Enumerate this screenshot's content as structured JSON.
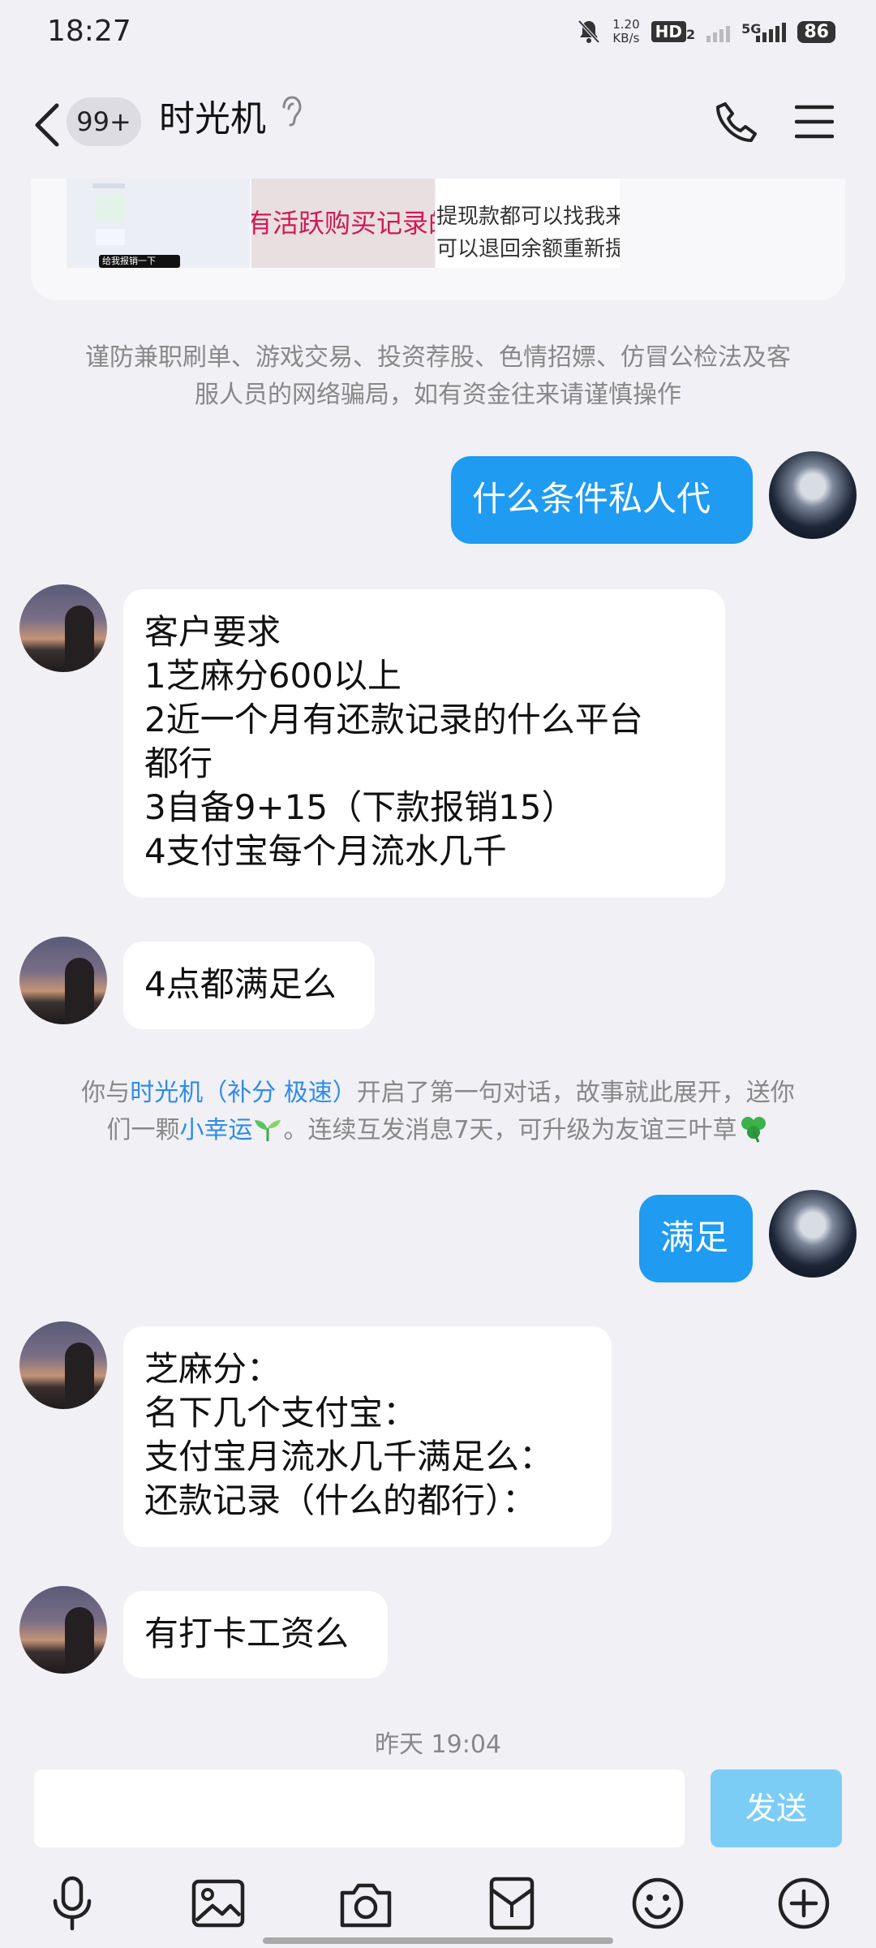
{
  "status_bar": {
    "time": "18:27",
    "net_speed_value": "1.20",
    "net_speed_unit": "KB/s",
    "hd_label": "HD",
    "hd_sub": "2",
    "network": "5G",
    "battery": "86"
  },
  "header": {
    "unread_count": "99+",
    "title": "时光机",
    "icons": [
      "back-arrow-icon",
      "ear-icon",
      "phone-icon",
      "menu-icon"
    ]
  },
  "image_preview": {
    "thumb2_text": "有活跃购买记录的来",
    "thumb3_line1": "提现款都可以找我来行",
    "thumb3_line2": "可以退回余额重新提现",
    "thumb1_button": "给我报销一下"
  },
  "system_warning": {
    "line1": "谨防兼职刷单、游戏交易、投资荐股、色情招嫖、仿冒公检法及客",
    "line2": "服人员的网络骗局，如有资金往来请谨慎操作"
  },
  "messages": [
    {
      "from": "me",
      "lines": [
        "什么条件私人代"
      ]
    },
    {
      "from": "other",
      "lines": [
        "客户要求",
        "1芝麻分600以上",
        "2近一个月有还款记录的什么平台",
        "都行",
        "3自备9+15（下款报销15）",
        "4支付宝每个月流水几千"
      ]
    },
    {
      "from": "other",
      "lines": [
        "4点都满足么"
      ]
    },
    {
      "from": "me",
      "lines": [
        "满足"
      ]
    },
    {
      "from": "other",
      "lines": [
        "芝麻分：",
        "名下几个支付宝：",
        "支付宝月流水几千满足么：",
        "还款记录（什么的都行）："
      ]
    },
    {
      "from": "other",
      "lines": [
        "有打卡工资么"
      ]
    }
  ],
  "friendship_notice": {
    "prefix": "你与",
    "name": "时光机（补分 极速）",
    "middle": "开启了第一句对话，故事就此展开，送你",
    "line2_prefix": "们一颗",
    "badge": "小幸运",
    "line2_suffix": "。连续互发消息7天，可升级为友谊三叶草"
  },
  "timestamp": "昨天 19:04",
  "input": {
    "value": "",
    "send_label": "发送"
  },
  "toolbar": [
    "microphone-icon",
    "image-icon",
    "camera-icon",
    "red-packet-icon",
    "emoji-icon",
    "plus-icon"
  ],
  "colors": {
    "background": "#f0f0f5",
    "outgoing_bubble": "#1f9bf2",
    "incoming_bubble": "#ffffff",
    "link": "#2f8ce8",
    "send_button_disabled": "#7ccdf6"
  }
}
